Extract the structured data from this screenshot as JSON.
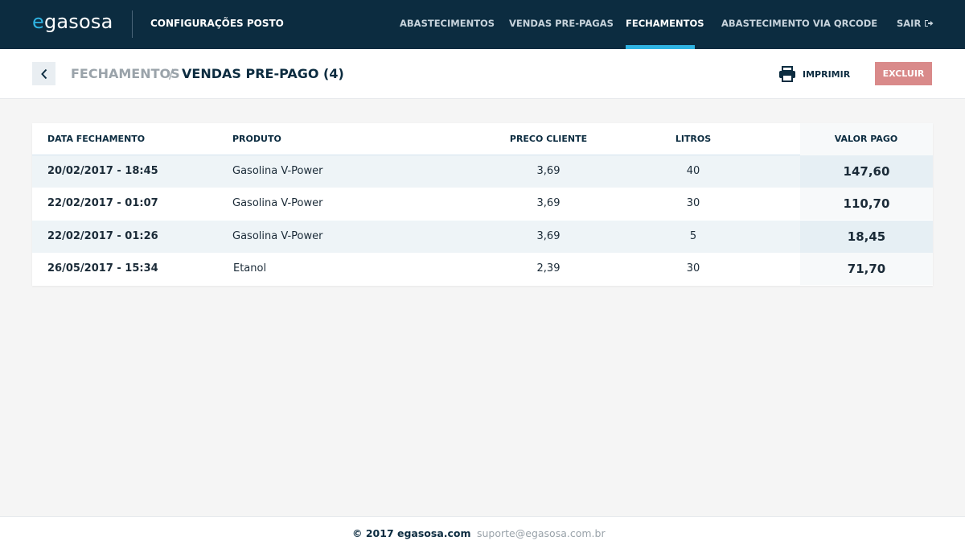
{
  "header": {
    "logo": {
      "prefix": "e",
      "rest": "gasosa"
    },
    "station_settings": "CONFIGURAÇÕES POSTO",
    "nav": [
      {
        "label": "ABASTECIMENTOS",
        "active": false
      },
      {
        "label": "VENDAS PRE-PAGAS",
        "active": false
      },
      {
        "label": "FECHAMENTOS",
        "active": true
      },
      {
        "label": "ABASTECIMENTO VIA QRCODE",
        "active": false
      }
    ],
    "logout": "SAIR",
    "logout_icon": "logout-icon"
  },
  "subheader": {
    "back_icon": "chevron-left-icon",
    "breadcrumb_parent": "FECHAMENTOS",
    "breadcrumb_separator": "/",
    "breadcrumb_current": "VENDAS PRE-PAGO (4)",
    "print_label": "IMPRIMIR",
    "print_icon": "printer-icon",
    "delete_label": "EXCLUIR"
  },
  "table": {
    "columns": {
      "date": "DATA FECHAMENTO",
      "product": "PRODUTO",
      "price": "PRECO CLIENTE",
      "liters": "LITROS",
      "paid": "VALOR PAGO"
    },
    "rows": [
      {
        "date": "20/02/2017 - 18:45",
        "product": "Gasolina V-Power",
        "price": "3,69",
        "liters": "40",
        "paid": "147,60"
      },
      {
        "date": "22/02/2017 - 01:07",
        "product": "Gasolina V-Power",
        "price": "3,69",
        "liters": "30",
        "paid": "110,70"
      },
      {
        "date": "22/02/2017 - 01:26",
        "product": "Gasolina V-Power",
        "price": "3,69",
        "liters": "5",
        "paid": "18,45"
      },
      {
        "date": "26/05/2017 - 15:34",
        "product": "Etanol",
        "price": "2,39",
        "liters": "30",
        "paid": "71,70"
      }
    ]
  },
  "footer": {
    "copyright": "© 2017 egasosa.com",
    "support_email": "suporte@egasosa.com.br"
  },
  "colors": {
    "navbar": "#0c2c40",
    "accent": "#2fb3e2",
    "delete": "#d98a8a"
  }
}
